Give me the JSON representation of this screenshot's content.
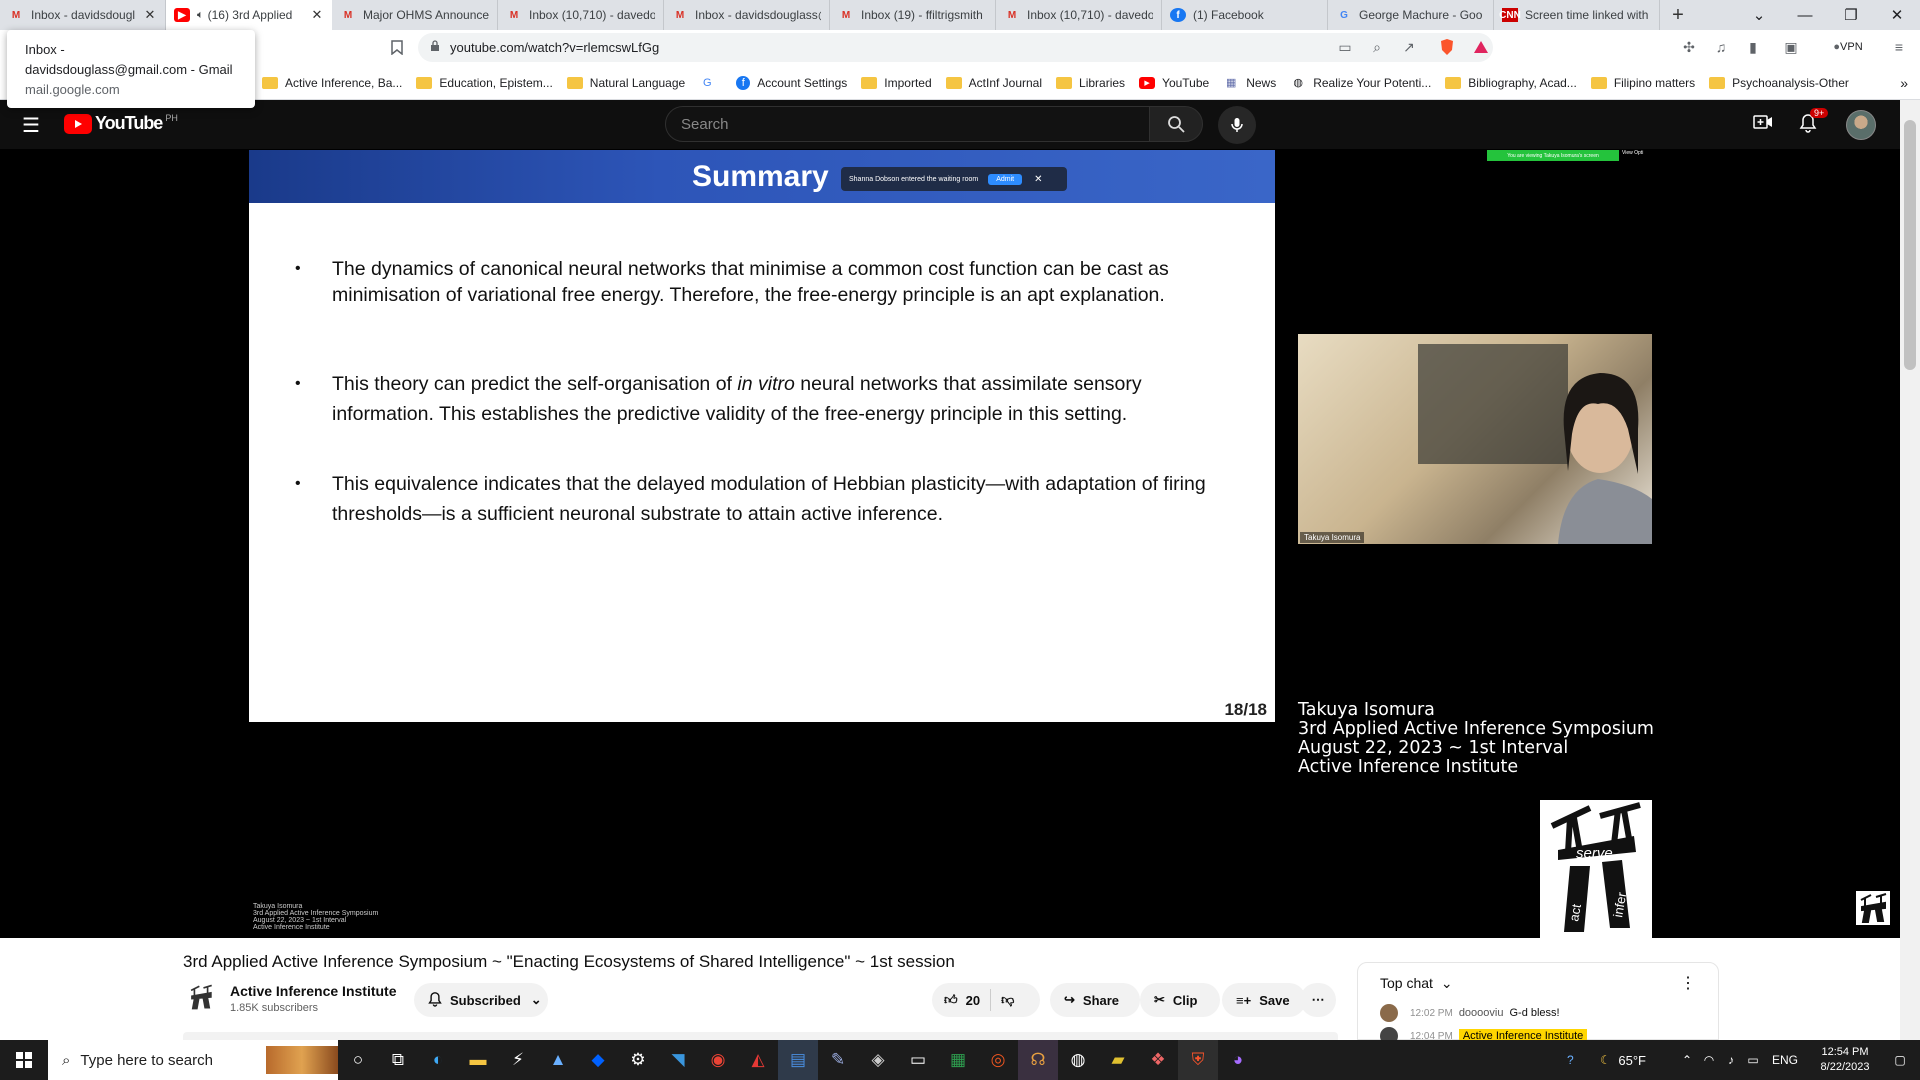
{
  "browser": {
    "tabs": [
      {
        "label": "Inbox - davidsdougl",
        "icon": "gmail-icon",
        "active": false
      },
      {
        "label": "(16) 3rd Applied",
        "icon": "youtube-icon",
        "active": true
      },
      {
        "label": "Major OHMS Announce",
        "icon": "gmail-icon",
        "active": false
      },
      {
        "label": "Inbox (10,710) - davedo",
        "icon": "gmail-icon",
        "active": false
      },
      {
        "label": "Inbox - davidsdouglass@",
        "icon": "gmail-icon",
        "active": false
      },
      {
        "label": "Inbox (19) - ffiltrigsmith",
        "icon": "gmail-icon",
        "active": false
      },
      {
        "label": "Inbox (10,710) - davedo",
        "icon": "gmail-icon",
        "active": false
      },
      {
        "label": "(1) Facebook",
        "icon": "facebook-icon",
        "active": false
      },
      {
        "label": "George Machure - Goo",
        "icon": "google-icon",
        "active": false
      },
      {
        "label": "Screen time linked with",
        "icon": "cnn-icon",
        "active": false
      }
    ],
    "url": "youtube.com/watch?v=rlemcswLfGg",
    "vpn_label": "VPN",
    "bookmarks": [
      {
        "label": "Active Inference, Ba...",
        "type": "folder"
      },
      {
        "label": "Education, Epistem...",
        "type": "folder"
      },
      {
        "label": "Natural Language",
        "type": "folder"
      },
      {
        "label": "",
        "type": "google"
      },
      {
        "label": "Account Settings",
        "type": "facebook"
      },
      {
        "label": "Imported",
        "type": "folder"
      },
      {
        "label": "ActInf Journal",
        "type": "folder"
      },
      {
        "label": "Libraries",
        "type": "folder"
      },
      {
        "label": "YouTube",
        "type": "youtube"
      },
      {
        "label": "News",
        "type": "news"
      },
      {
        "label": "Realize Your Potenti...",
        "type": "site"
      },
      {
        "label": "Bibliography, Acad...",
        "type": "folder"
      },
      {
        "label": "Filipino matters",
        "type": "folder"
      },
      {
        "label": "Psychoanalysis-Other",
        "type": "folder"
      }
    ],
    "tooltip": {
      "line1": "Inbox -",
      "line2": "davidsdouglass@gmail.com - Gmail",
      "line3": "mail.google.com"
    }
  },
  "youtube": {
    "logo_text": "YouTube",
    "region": "PH",
    "search_placeholder": "Search",
    "notification_count": "9+"
  },
  "video": {
    "slide_title": "Summary",
    "zoom_notice": "Shanna Dobson entered the waiting room",
    "zoom_admit": "Admit",
    "bullets": [
      "The dynamics of canonical neural networks that minimise a common cost function can be cast as minimisation of variational free energy. Therefore, the free-energy principle is an apt explanation.",
      "This theory can predict the self-organisation of in vitro neural networks that assimilate sensory information. This establishes the predictive validity of the free-energy principle in this setting.",
      "This equivalence indicates that the delayed modulation of Hebbian plasticity—with adaptation of firing thresholds—is a sufficient neuronal substrate to attain active inference."
    ],
    "bullet2_parts": {
      "before": "This theory can predict the self-organisation of ",
      "italic": "in vitro",
      "after": " neural networks that assimilate sensory information. This establishes the predictive validity of the free-energy principle in this setting."
    },
    "slide_number": "18/18",
    "viewing_banner": "You are viewing Takuya Isomura's screen",
    "view_options": "View Opti",
    "speaker_tile_name": "Takuya Isomura",
    "credits": [
      "Takuya Isomura",
      "3rd Applied Active Inference Symposium",
      "August 22, 2023 ~ 1st Interval",
      "Active Inference Institute"
    ],
    "logo_words": {
      "serve": "serve",
      "act": "act",
      "infer": "infer"
    }
  },
  "below_video": {
    "title": "3rd Applied Active Inference Symposium ~ \"Enacting Ecosystems of Shared Intelligence\" ~ 1st session",
    "channel_name": "Active Inference Institute",
    "subscribers": "1.85K subscribers",
    "subscribed_label": "Subscribed",
    "like_count": "20",
    "share_label": "Share",
    "clip_label": "Clip",
    "save_label": "Save",
    "chat_header": "Top chat",
    "chat_lines": [
      {
        "time": "12:02 PM",
        "author": "dooooviu",
        "text": "G-d bless!"
      },
      {
        "time": "12:04 PM",
        "author": "Active Inference Institute",
        "text": ""
      }
    ]
  },
  "taskbar": {
    "search_placeholder": "Type here to search",
    "weather": "65°F",
    "language": "ENG",
    "time": "12:54 PM",
    "date": "8/22/2023"
  }
}
